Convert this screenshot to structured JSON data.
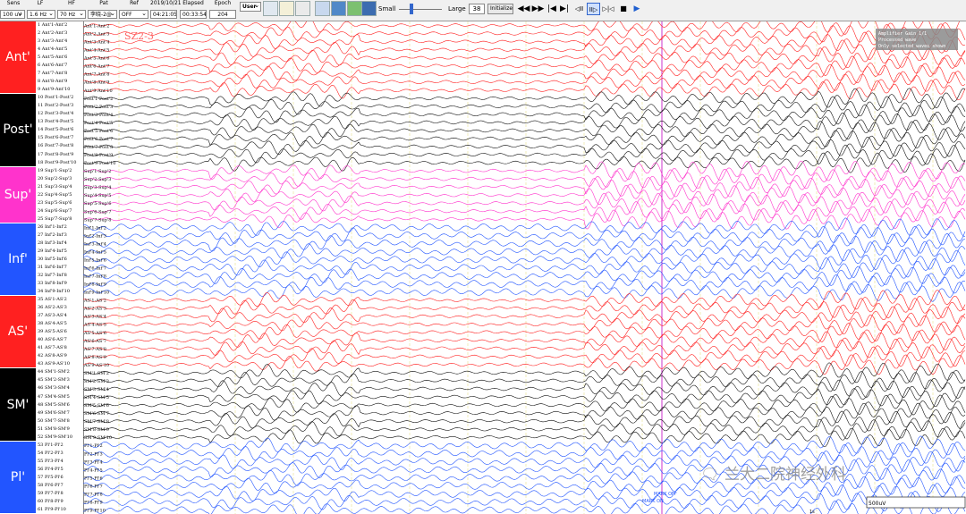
{
  "toolbar": {
    "sens": {
      "label": "Sens",
      "value": "100 uV"
    },
    "lf": {
      "label": "LF",
      "value": "1.6 Hz"
    },
    "hf": {
      "label": "HF",
      "value": "70 Hz"
    },
    "pat": {
      "label": "Pat",
      "value": "李晓-2@"
    },
    "ref": {
      "label": "Ref",
      "value": "OFF"
    },
    "date": {
      "label": "2019/10/21",
      "value": "04:21:05"
    },
    "elapsed": {
      "label": "Elapsed",
      "value": "00:33:54"
    },
    "epoch": {
      "label": "Epoch",
      "value": "204"
    },
    "user": "User",
    "small": "Small",
    "large": "Large",
    "gain_value": "38",
    "initialize": "Initialize",
    "playback": [
      "◀◀",
      "▶▶",
      "|◀",
      "▶|",
      "◁II",
      "II▷",
      "▷|◁",
      "■",
      "▶"
    ]
  },
  "groups": [
    {
      "name": "Ant'",
      "color": "#ff2020",
      "text": "#ffffff"
    },
    {
      "name": "Post'",
      "color": "#000000",
      "text": "#ffffff"
    },
    {
      "name": "Sup'",
      "color": "#ff33cc",
      "text": "#ffffff"
    },
    {
      "name": "Inf'",
      "color": "#2255ff",
      "text": "#ffffff"
    },
    {
      "name": "AS'",
      "color": "#ff2020",
      "text": "#ffffff"
    },
    {
      "name": "SM'",
      "color": "#000000",
      "text": "#ffffff"
    },
    {
      "name": "Pl'",
      "color": "#2255ff",
      "text": "#ffffff"
    }
  ],
  "channels": {
    "label_prefix": [
      "Ant'",
      "Post'",
      "Sup'",
      "Inf'",
      "AS'",
      "SM'",
      "Pl'"
    ],
    "counts": [
      9,
      9,
      7,
      9,
      9,
      9,
      9
    ],
    "colors": [
      "#ff2020",
      "#111111",
      "#ff33cc",
      "#2255ff",
      "#ff2020",
      "#111111",
      "#2255ff"
    ]
  },
  "overlay": {
    "annotation": "SZ2-3",
    "info_lines": [
      "Amplifier Gain 1/1",
      "Processed wave",
      "Only selected waves shown"
    ],
    "marker_off": "MARK OFF",
    "marker_on": "MARK ON",
    "scale_label": "500uV",
    "time_label": "1s"
  },
  "watermark": "🗨 兰大二院神经外科"
}
